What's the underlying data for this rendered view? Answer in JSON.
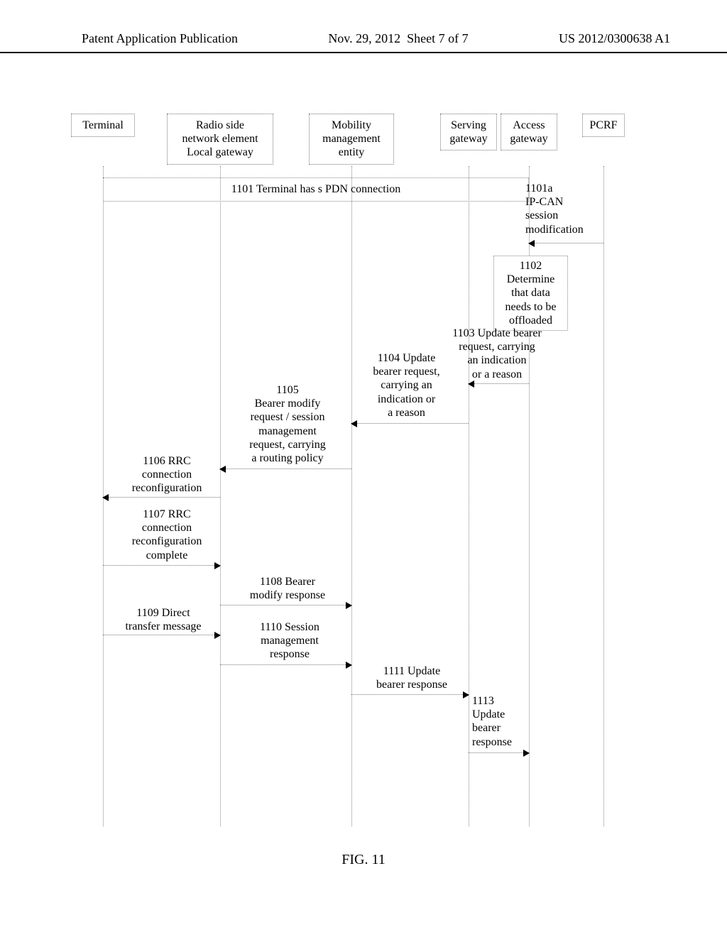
{
  "header": {
    "left": "Patent Application Publication",
    "center": "Nov. 29, 2012  Sheet 7 of 7",
    "right": "US 2012/0300638 A1"
  },
  "participants": {
    "terminal": "Terminal",
    "radio": "Radio side\nnetwork element\nLocal gateway",
    "mme": "Mobility\nmanagement\nentity",
    "sgw": "Serving\ngateway",
    "agw": "Access\ngateway",
    "pcrf": "PCRF"
  },
  "frame1101": "1101 Terminal has s PDN connection",
  "proc1102": "1102\nDetermine\nthat data\nneeds to be\noffloaded",
  "msgs": {
    "m1101a": "1101a\nIP-CAN\nsession\nmodification",
    "m1103": "1103 Update bearer\nrequest, carrying\nan indication\nor a reason",
    "m1104": "1104 Update\nbearer request,\ncarrying an\nindication or\na reason",
    "m1105": "1105\nBearer modify\nrequest / session\nmanagement\nrequest, carrying\na routing policy",
    "m1106": "1106 RRC\nconnection\nreconfiguration",
    "m1107": "1107 RRC\nconnection\nreconfiguration\ncomplete",
    "m1108": "1108 Bearer\nmodify response",
    "m1109": "1109 Direct\ntransfer message",
    "m1110": "1110 Session\nmanagement\nresponse",
    "m1111": "1111 Update\nbearer response",
    "m1113": "1113\nUpdate\nbearer\nresponse"
  },
  "caption": "FIG. 11"
}
